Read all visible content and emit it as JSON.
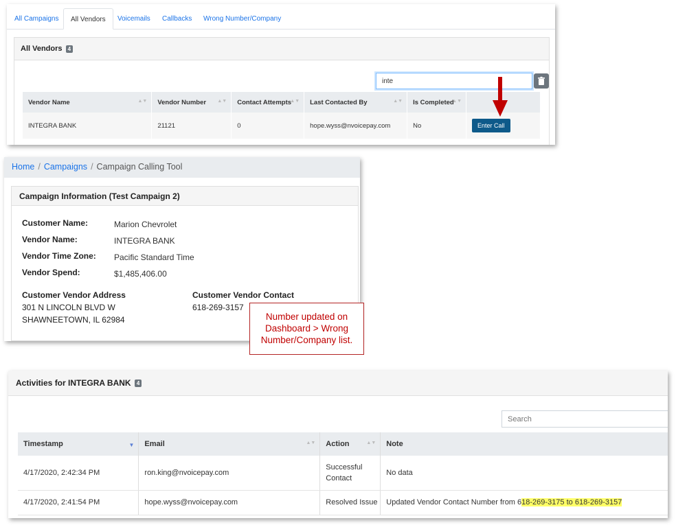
{
  "tabs": [
    {
      "label": "All Campaigns",
      "active": false
    },
    {
      "label": "All Vendors",
      "active": true
    },
    {
      "label": "Voicemails",
      "active": false
    },
    {
      "label": "Callbacks",
      "active": false
    },
    {
      "label": "Wrong Number/Company",
      "active": false
    }
  ],
  "vendors_card": {
    "title": "All Vendors",
    "count": "4",
    "search_value": "inte",
    "columns": [
      "Vendor Name",
      "Vendor Number",
      "Contact Attempts",
      "Last Contacted By",
      "Is Completed",
      ""
    ],
    "rows": [
      {
        "vendor_name": "INTEGRA BANK",
        "vendor_number": "21121",
        "contact_attempts": "0",
        "last_contacted_by": "hope.wyss@nvoicepay.com",
        "is_completed": "No",
        "action": "Enter Call"
      }
    ]
  },
  "breadcrumb": {
    "home": "Home",
    "campaigns": "Campaigns",
    "current": "Campaign Calling Tool"
  },
  "campaign": {
    "title": "Campaign Information (Test Campaign 2)",
    "fields": [
      {
        "label": "Customer Name:",
        "value": "Marion Chevrolet"
      },
      {
        "label": "Vendor Name:",
        "value": "INTEGRA BANK"
      },
      {
        "label": "Vendor Time Zone:",
        "value": "Pacific Standard Time"
      },
      {
        "label": "Vendor Spend:",
        "value": "$1,485,406.00"
      }
    ],
    "address_heading": "Customer Vendor Address",
    "address_line1": "301 N LINCOLN BLVD W",
    "address_line2": "SHAWNEETOWN, IL 62984",
    "contact_heading": "Customer Vendor Contact",
    "contact_value": "618-269-3157"
  },
  "callout": {
    "line1": "Number updated on",
    "line2": "Dashboard > Wrong",
    "line3": "Number/Company list."
  },
  "activities": {
    "title": "Activities for INTEGRA BANK",
    "count": "4",
    "search_placeholder": "Search",
    "columns": [
      "Timestamp",
      "Email",
      "Action",
      "Note"
    ],
    "rows": [
      {
        "timestamp": "4/17/2020, 2:42:34 PM",
        "email": "ron.king@nvoicepay.com",
        "action_line1": "Successful",
        "action_line2": "Contact",
        "note_prefix": "No data",
        "note_highlight": ""
      },
      {
        "timestamp": "4/17/2020, 2:41:54 PM",
        "email": "hope.wyss@nvoicepay.com",
        "action_line1": "Resolved Issue",
        "action_line2": "",
        "note_prefix": "Updated Vendor Contact Number from 6",
        "note_highlight": "18-269-3175 to 618-269-3157"
      }
    ]
  },
  "colors": {
    "link": "#1a73e8",
    "enter_call_button": "#0e5a8a",
    "arrow": "#c00000",
    "callout_border": "#b22222",
    "highlight": "#ffff66"
  }
}
